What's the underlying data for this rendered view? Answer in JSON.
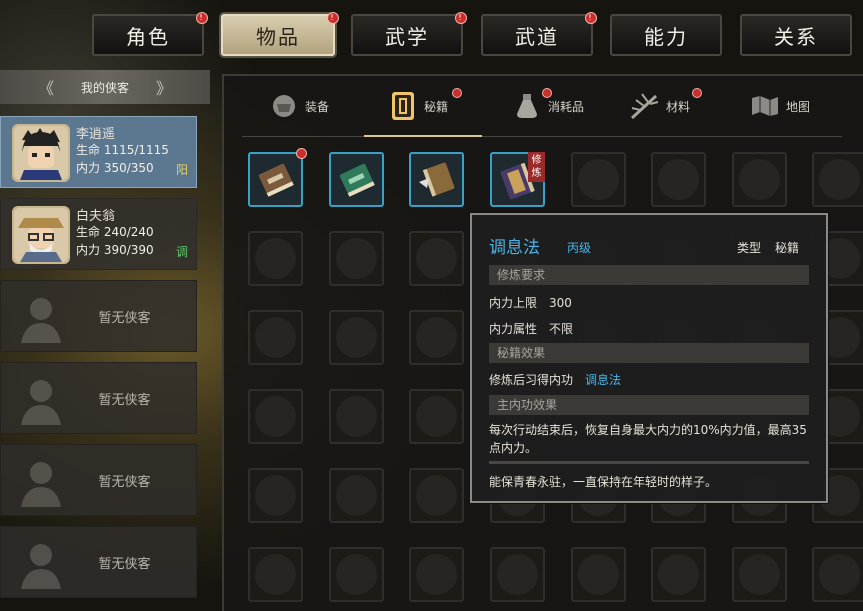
{
  "top_tabs": [
    {
      "label": "角色",
      "badge": true
    },
    {
      "label": "物品",
      "badge": true,
      "active": true
    },
    {
      "label": "武学",
      "badge": true
    },
    {
      "label": "武道",
      "badge": true
    },
    {
      "label": "能力",
      "badge": false
    },
    {
      "label": "关系",
      "badge": false
    }
  ],
  "badge_mark": "!",
  "left_panel": {
    "header": "我的侠客",
    "nav_left": "《",
    "nav_right": "》",
    "characters": [
      {
        "name": "李逍遥",
        "life": "生命 1115/1115",
        "inner": "内力 350/350",
        "affinity": "阳",
        "selected": true
      },
      {
        "name": "白夫翁",
        "life": "生命 240/240",
        "inner": "内力 390/390",
        "affinity": "调",
        "selected": false
      }
    ],
    "empty_label": "暂无侠客"
  },
  "sub_tabs": [
    {
      "label": "装备",
      "icon": "armor-icon"
    },
    {
      "label": "秘籍",
      "icon": "manual-icon",
      "active": true,
      "badge": true
    },
    {
      "label": "消耗品",
      "icon": "potion-icon",
      "badge": true
    },
    {
      "label": "材料",
      "icon": "herb-icon",
      "badge": true
    },
    {
      "label": "地图",
      "icon": "map-icon"
    }
  ],
  "inventory": {
    "items": [
      {
        "icon": "brown-book-icon",
        "badge": true
      },
      {
        "icon": "green-book-icon"
      },
      {
        "icon": "scroll-book-icon"
      },
      {
        "icon": "purple-book-icon",
        "training": "修炼"
      }
    ]
  },
  "tooltip": {
    "title": "调息法",
    "level": "丙级",
    "type_label": "类型",
    "type_value": "秘籍",
    "sec_req": "修炼要求",
    "req_rows": [
      {
        "k": "内力上限",
        "v": "300"
      },
      {
        "k": "内力属性",
        "v": "不限"
      }
    ],
    "sec_effect": "秘籍效果",
    "effect_key": "修炼后习得内功",
    "effect_val": "调息法",
    "sec_main": "主内功效果",
    "main_desc": "每次行动结束后，恢复自身最大内力的10%内力值，最高35点内力。",
    "flavor": "能保青春永驻，一直保持在年轻时的样子。"
  },
  "colors": {
    "accent_blue": "#4ab3e8",
    "badge_red": "#c9302c",
    "selected_blue": "#5c7890",
    "active_tab": "#d9cdb0"
  }
}
